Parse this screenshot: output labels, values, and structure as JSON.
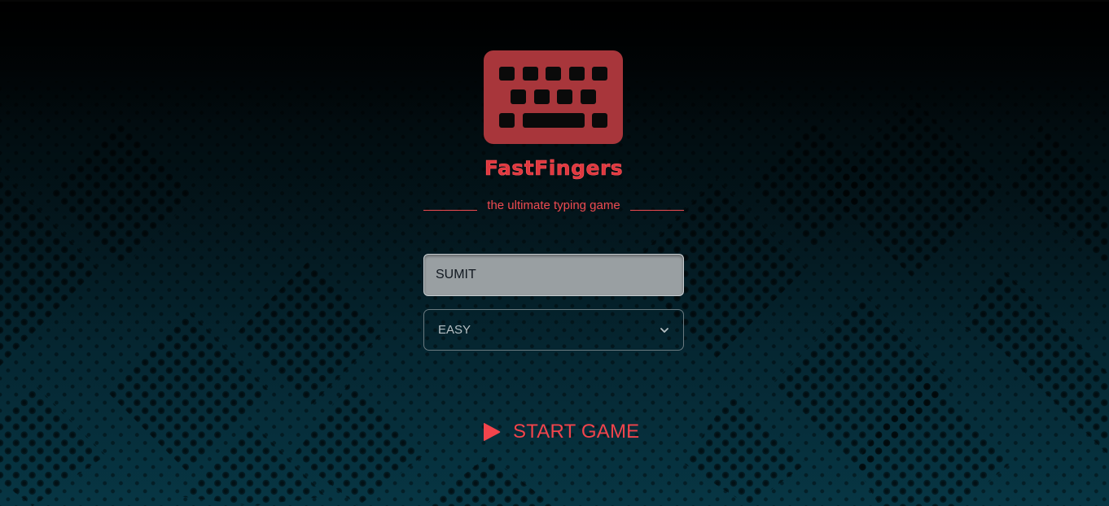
{
  "app": {
    "brand": "FastFingers",
    "tagline": "the ultimate typing game"
  },
  "form": {
    "player_name": "SUMIT",
    "level_selected": "EASY",
    "start_label": "START GAME"
  },
  "icons": {
    "logo": "keyboard-icon",
    "select_arrow": "chevron-down-icon",
    "start": "play-icon"
  },
  "colors": {
    "accent": "#e0383f",
    "logo_bg": "#a8363b",
    "input_bg": "#999fa2",
    "background_top": "#010203",
    "background_bottom": "#073644"
  }
}
